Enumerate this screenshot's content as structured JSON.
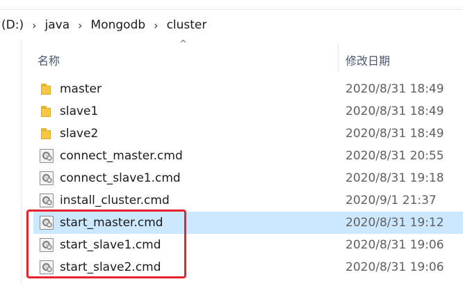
{
  "address": {
    "crumbs": [
      "(D:)",
      "java",
      "Mongodb",
      "cluster"
    ],
    "separator": "›"
  },
  "columns": {
    "name": "名称",
    "date": "修改日期",
    "sort_indicator": "^"
  },
  "files": [
    {
      "name": "master",
      "date": "2020/8/31 18:49",
      "icon": "folder-icon"
    },
    {
      "name": "slave1",
      "date": "2020/8/31 18:49",
      "icon": "folder-icon"
    },
    {
      "name": "slave2",
      "date": "2020/8/31 18:49",
      "icon": "folder-icon"
    },
    {
      "name": "connect_master.cmd",
      "date": "2020/8/31 20:55",
      "icon": "cmd-file-icon"
    },
    {
      "name": "connect_slave1.cmd",
      "date": "2020/8/31 19:18",
      "icon": "cmd-file-icon"
    },
    {
      "name": "install_cluster.cmd",
      "date": "2020/9/1 21:37",
      "icon": "cmd-file-icon"
    },
    {
      "name": "start_master.cmd",
      "date": "2020/8/31 19:12",
      "icon": "cmd-file-icon"
    },
    {
      "name": "start_slave1.cmd",
      "date": "2020/8/31 19:06",
      "icon": "cmd-file-icon"
    },
    {
      "name": "start_slave2.cmd",
      "date": "2020/8/31 19:06",
      "icon": "cmd-file-icon"
    }
  ],
  "selected_index": 6,
  "colors": {
    "selection": "#cce8ff",
    "highlight_border": "#e8222b"
  }
}
